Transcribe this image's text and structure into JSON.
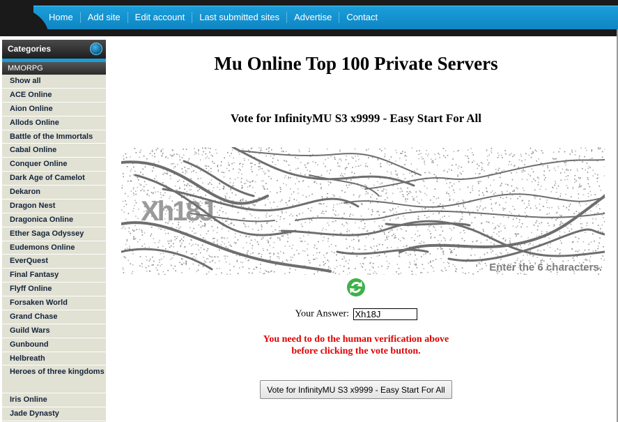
{
  "nav": {
    "items": [
      "Home",
      "Add site",
      "Edit account",
      "Last submitted sites",
      "Advertise",
      "Contact"
    ]
  },
  "sidebar": {
    "header": "Categories",
    "group": "MMORPG",
    "items": [
      "Show all",
      "ACE Online",
      "Aion Online",
      "Allods Online",
      "Battle of the Immortals",
      "Cabal Online",
      "Conquer Online",
      "Dark Age of Camelot",
      "Dekaron",
      "Dragon Nest",
      "Dragonica Online",
      "Ether Saga Odyssey",
      "Eudemons Online",
      "EverQuest",
      "Final Fantasy",
      "Flyff Online",
      "Forsaken World",
      "Grand Chase",
      "Guild Wars",
      "Gunbound",
      "Helbreath",
      "Heroes of three kingdoms",
      "Iris Online",
      "Jade Dynasty"
    ]
  },
  "main": {
    "title": "Mu Online Top 100 Private Servers",
    "vote_heading": "Vote for InfinityMU S3 x9999 - Easy Start For All",
    "captcha": {
      "distorted_text": "Xh18J",
      "hint": "Enter the 6 characters."
    },
    "answer_label": "Your Answer:",
    "answer_value": "Xh18J",
    "error_line1": "You need to do the human verification above",
    "error_line2": "before clicking the vote button.",
    "vote_button": "Vote for InfinityMU S3 x9999 - Easy Start For All"
  },
  "colors": {
    "nav_blue": "#1a9ed9",
    "error_red": "#e00000",
    "sidebar_bg": "#e1e1d4"
  }
}
